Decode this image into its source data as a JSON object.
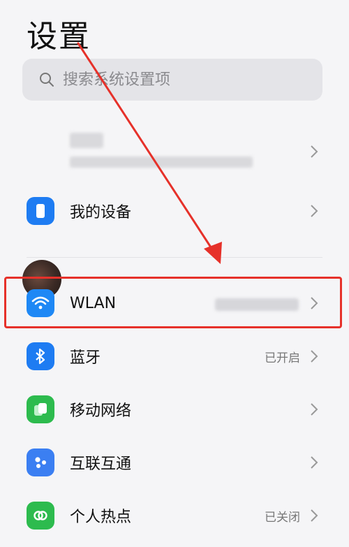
{
  "header": {
    "title": "设置"
  },
  "search": {
    "placeholder": "搜索系统设置项"
  },
  "account": {},
  "rows": [
    {
      "label": "我的设备",
      "value": "",
      "icon": "phone-device-icon",
      "color": "#1e7cf2"
    },
    {
      "label": "WLAN",
      "value": "",
      "icon": "wifi-icon",
      "color": "#1e88f5"
    },
    {
      "label": "蓝牙",
      "value": "已开启",
      "icon": "bluetooth-icon",
      "color": "#1e7cf2"
    },
    {
      "label": "移动网络",
      "value": "",
      "icon": "mobile-network-icon",
      "color": "#2dbb4e"
    },
    {
      "label": "互联互通",
      "value": "",
      "icon": "interconnect-icon",
      "color": "#3b7ff2"
    },
    {
      "label": "个人热点",
      "value": "已关闭",
      "icon": "hotspot-icon",
      "color": "#2dbb4e"
    }
  ],
  "colors": {
    "highlight": "#e6312a",
    "arrow": "#e6312a",
    "background": "#f5f5f7"
  }
}
